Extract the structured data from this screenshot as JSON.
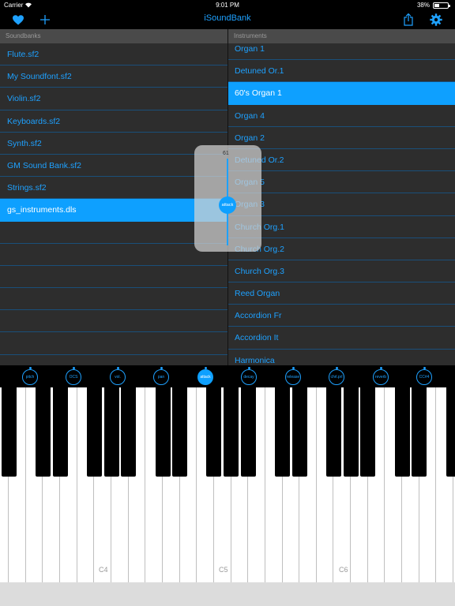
{
  "status": {
    "carrier": "Carrier",
    "wifi": "wifi-icon",
    "time": "9:01 PM",
    "battery": "38%"
  },
  "nav": {
    "title": "iSoundBank",
    "icons": [
      "heart-icon",
      "plus-icon",
      "share-icon",
      "gear-icon"
    ],
    "accent": "#1ea1ff"
  },
  "soundbanks": {
    "header": "Soundbanks",
    "items": [
      {
        "label": "Flute.sf2"
      },
      {
        "label": "My Soundfont.sf2"
      },
      {
        "label": "Violin.sf2"
      },
      {
        "label": "Keyboards.sf2"
      },
      {
        "label": "Synth.sf2"
      },
      {
        "label": "GM Sound Bank.sf2"
      },
      {
        "label": "Strings.sf2"
      },
      {
        "label": "gs_instruments.dls",
        "selected": true
      }
    ]
  },
  "instruments": {
    "header": "Instruments",
    "items": [
      {
        "label": "Organ 1"
      },
      {
        "label": "Detuned Or.1"
      },
      {
        "label": "60's Organ 1",
        "selected": true
      },
      {
        "label": "Organ 4"
      },
      {
        "label": "Organ 2"
      },
      {
        "label": "Detuned Or.2"
      },
      {
        "label": "Organ 5"
      },
      {
        "label": "Organ 3"
      },
      {
        "label": "Church Org.1"
      },
      {
        "label": "Church Org.2"
      },
      {
        "label": "Church Org.3"
      },
      {
        "label": "Reed Organ"
      },
      {
        "label": "Accordion Fr"
      },
      {
        "label": "Accordion It"
      },
      {
        "label": "Harmonica"
      }
    ]
  },
  "slider": {
    "value": "61",
    "label": "attack"
  },
  "knobs": [
    {
      "label": "pitch"
    },
    {
      "label": "OCS"
    },
    {
      "label": "vol."
    },
    {
      "label": "pan"
    },
    {
      "label": "attack",
      "active": true
    },
    {
      "label": "decay"
    },
    {
      "label": "release"
    },
    {
      "label": "chrl.prl"
    },
    {
      "label": "reverb"
    },
    {
      "label": "CC#4"
    }
  ],
  "keyboard": {
    "octave_labels": [
      "C4",
      "C5",
      "C6"
    ]
  }
}
